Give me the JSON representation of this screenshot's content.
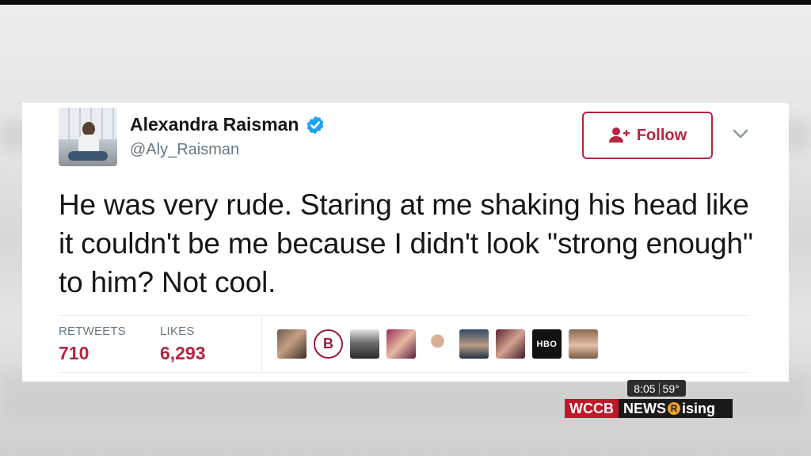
{
  "tweet": {
    "author_name": "Alexandra Raisman",
    "author_handle": "@Aly_Raisman",
    "follow_label": "Follow",
    "text": "He was very rude. Staring at me shaking his head like it couldn't be me because I didn't look \"strong enough\" to him? Not cool.",
    "stats": {
      "retweets_label": "RETWEETS",
      "retweets_value": "710",
      "likes_label": "LIKES",
      "likes_value": "6,293"
    },
    "likers": [
      {
        "icon": "liker-avatar-1"
      },
      {
        "icon": "liker-avatar-b-logo",
        "text": "B"
      },
      {
        "icon": "liker-avatar-3"
      },
      {
        "icon": "liker-avatar-4"
      },
      {
        "icon": "liker-avatar-5"
      },
      {
        "icon": "liker-avatar-6"
      },
      {
        "icon": "liker-avatar-7"
      },
      {
        "icon": "liker-avatar-hbo-logo",
        "text": "HBO"
      },
      {
        "icon": "liker-avatar-9"
      }
    ]
  },
  "broadcast": {
    "time": "8:05",
    "temperature": "59°",
    "logo_channel": "WCCB",
    "logo_news": "NEWS",
    "logo_r": "R",
    "logo_rising": "ising"
  },
  "colors": {
    "accent": "#b5253f",
    "verified": "#1da1f2",
    "handle_gray": "#657786",
    "text": "#14171a"
  }
}
